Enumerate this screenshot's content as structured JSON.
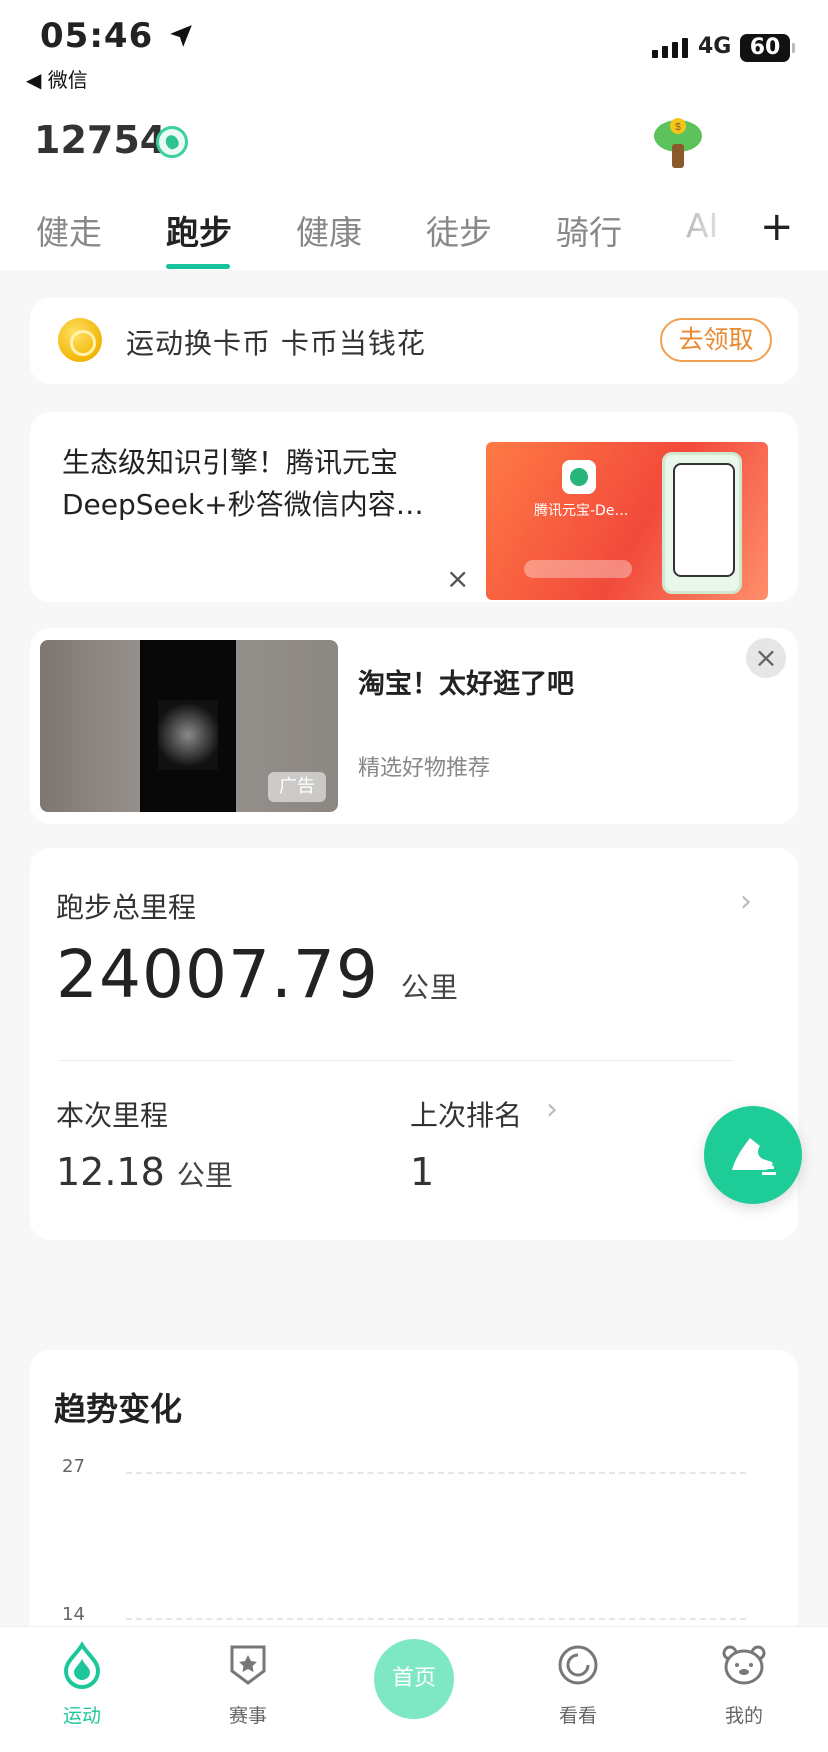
{
  "status_bar": {
    "time": "05:46",
    "back_label": "◀ 微信",
    "network": "4G",
    "battery": "60"
  },
  "header": {
    "step_count": "12754"
  },
  "tabs": [
    {
      "label": "健走"
    },
    {
      "label": "跑步"
    },
    {
      "label": "健康"
    },
    {
      "label": "徒步"
    },
    {
      "label": "骑行"
    },
    {
      "label": "AI"
    }
  ],
  "active_tab": "跑步",
  "promo": {
    "text": "运动换卡币  卡币当钱花",
    "button": "去领取"
  },
  "ad1": {
    "title": "生态级知识引擎！腾讯元宝DeepSeek+秒答微信内容…",
    "image_caption": "腾讯元宝-De…",
    "close": "×"
  },
  "ad2": {
    "title": "淘宝！太好逛了吧",
    "subtitle": "精选好物推荐",
    "badge": "广告",
    "close": "×"
  },
  "stats": {
    "total_label": "跑步总里程",
    "total_value": "24007.79",
    "unit": "公里",
    "current_label": "本次里程",
    "current_value": "12.18",
    "rank_label": "上次排名",
    "rank_value": "1"
  },
  "trend": {
    "title": "趋势变化",
    "ticks": [
      "27",
      "14"
    ]
  },
  "nav": [
    {
      "label": "运动",
      "icon": "drop-icon"
    },
    {
      "label": "赛事",
      "icon": "badge-icon"
    },
    {
      "label": "首页",
      "icon": "home-circle"
    },
    {
      "label": "看看",
      "icon": "ring-icon"
    },
    {
      "label": "我的",
      "icon": "bear-icon"
    }
  ],
  "colors": {
    "accent": "#17c39a",
    "claim": "#e8892f"
  }
}
